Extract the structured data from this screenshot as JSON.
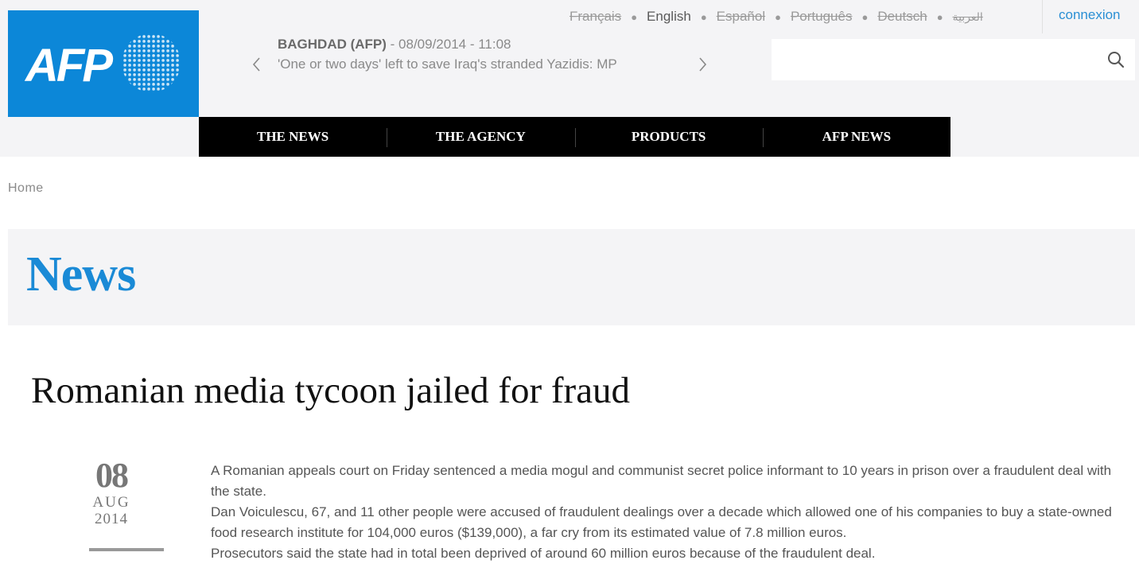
{
  "logo": {
    "text": "AFP",
    "brand_color": "#0c87d8"
  },
  "languages": [
    {
      "label": "Français",
      "active": false
    },
    {
      "label": "English",
      "active": true
    },
    {
      "label": "Español",
      "active": false
    },
    {
      "label": "Português",
      "active": false
    },
    {
      "label": "Deutsch",
      "active": false
    },
    {
      "label": "العربية",
      "active": false
    }
  ],
  "connexion_label": "connexion",
  "ticker": {
    "dateline": "BAGHDAD (AFP)",
    "datetime": " - 08/09/2014 - 11:08",
    "headline": "'One or two days' left to save Iraq's stranded Yazidis: MP",
    "prev_icon": "chevron-left-icon",
    "next_icon": "chevron-right-icon"
  },
  "search": {
    "placeholder": "",
    "icon": "search-icon"
  },
  "nav": [
    {
      "label": "THE NEWS"
    },
    {
      "label": "THE AGENCY"
    },
    {
      "label": "PRODUCTS"
    },
    {
      "label": "AFP NEWS"
    }
  ],
  "breadcrumb": "Home",
  "section_title": "News",
  "article": {
    "headline": "Romanian media tycoon jailed for fraud",
    "date": {
      "day": "08",
      "month": "AUG",
      "year": "2014"
    },
    "paragraphs": [
      "A Romanian appeals court on Friday sentenced a media mogul and communist secret police informant to 10 years in prison over a fraudulent deal with the state.",
      "Dan Voiculescu, 67, and 11 other people were accused of fraudulent dealings over a decade which allowed one of his companies to buy a state-owned food research institute for 104,000 euros ($139,000), a far cry from its estimated value of 7.8 million euros.",
      "Prosecutors said the state had in total been deprived of around 60 million euros because of the fraudulent deal."
    ]
  },
  "colors": {
    "accent": "#1a8ad6",
    "nav_background": "#000000",
    "header_background": "#f4f4f6"
  }
}
